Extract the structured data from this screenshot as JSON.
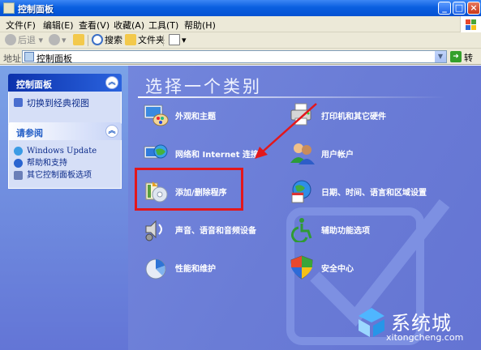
{
  "window": {
    "title": "控制面板"
  },
  "menu": [
    "文件(F)",
    "编辑(E)",
    "查看(V)",
    "收藏(A)",
    "工具(T)",
    "帮助(H)"
  ],
  "toolbar": {
    "back": "后退",
    "search": "搜索",
    "folders": "文件夹"
  },
  "address": {
    "label": "地址",
    "value": "控制面板",
    "go": "转到"
  },
  "sidebar": {
    "control_panel": {
      "title": "控制面板",
      "switch": "切换到经典视图"
    },
    "see_also": {
      "title": "请参阅",
      "items": [
        "Windows Update",
        "帮助和支持",
        "其它控制面板选项"
      ]
    }
  },
  "main": {
    "heading": "选择一个类别",
    "categories_left": [
      "外观和主题",
      "网络和 Internet 连接",
      "添加/删除程序",
      "声音、语音和音频设备",
      "性能和维护"
    ],
    "categories_right": [
      "打印机和其它硬件",
      "用户帐户",
      "日期、时间、语言和区域设置",
      "辅助功能选项",
      "安全中心"
    ]
  },
  "watermark": {
    "name": "系统城",
    "url": "xitongcheng.com"
  },
  "colors": {
    "highlight": "#e3171b",
    "main_bg": "#6c7ed8",
    "sidebar_bg": "#7096e2"
  }
}
